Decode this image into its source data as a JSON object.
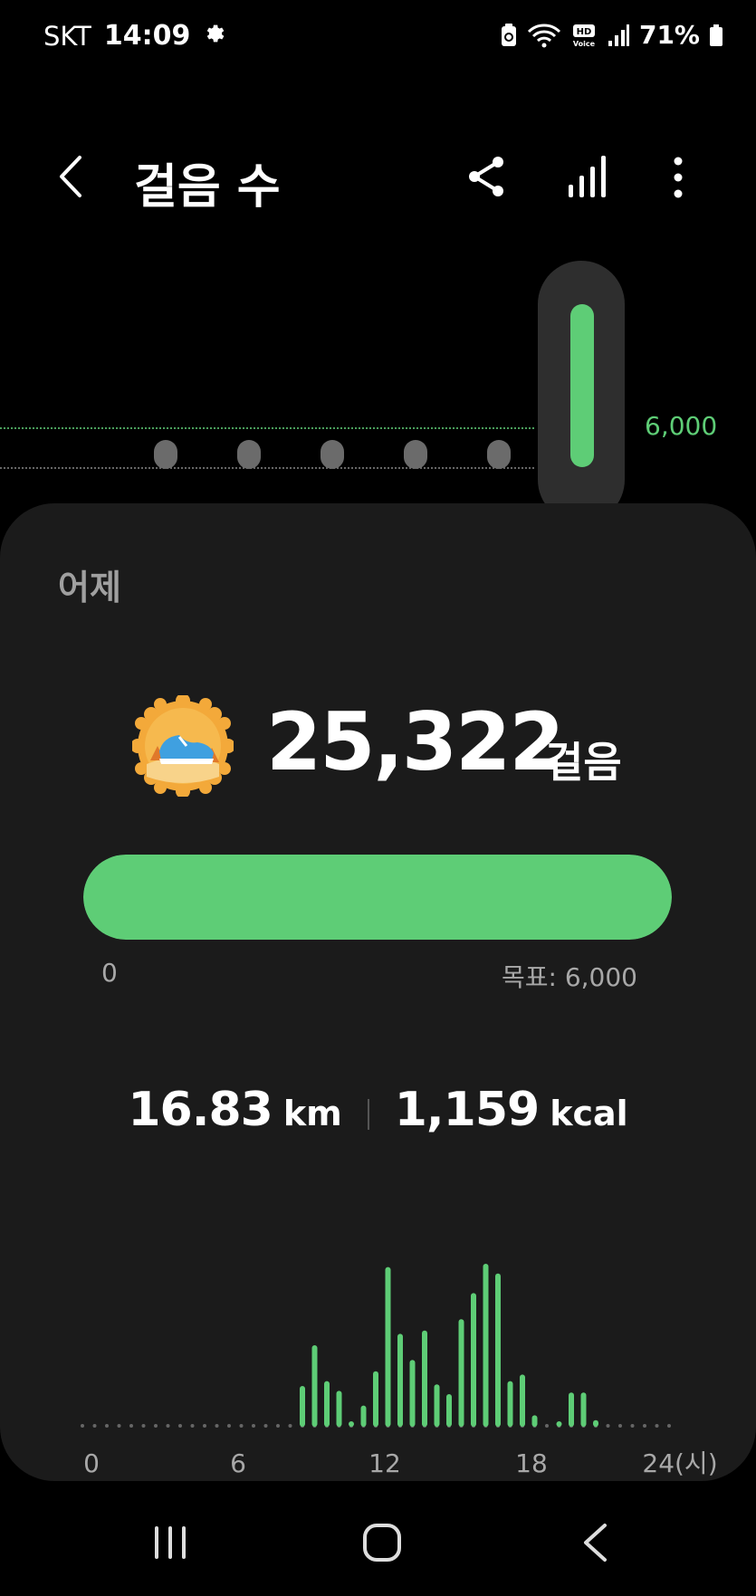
{
  "status_bar": {
    "carrier": "SKT",
    "time": "14:09",
    "battery": "71%",
    "icons": [
      "settings-gear-icon",
      "recycle-icon",
      "wifi-icon",
      "hd-voice-icon",
      "signal-icon",
      "battery-icon"
    ]
  },
  "header": {
    "title": "걸음 수",
    "icons": [
      "back-arrow-icon",
      "share-icon",
      "bar-chart-icon",
      "more-vertical-icon"
    ]
  },
  "weekly": {
    "goal_label": "6,000",
    "days_shown": 6,
    "selected_fraction_of_goal": 1.0
  },
  "summary": {
    "day_label": "어제",
    "steps": "25,322",
    "steps_unit": "걸음",
    "badge_icon": "sneaker-badge-icon",
    "progress_fraction": 1.0,
    "progress_min": "0",
    "progress_goal": "목표: 6,000",
    "distance_value": "16.83",
    "distance_unit": "km",
    "calories_value": "1,159",
    "calories_unit": "kcal"
  },
  "colors": {
    "accent": "#5ecd76",
    "card": "#1b1b1b",
    "muted_text": "#a8a8a8"
  },
  "chart_data": {
    "type": "bar",
    "title": "",
    "xlabel": "",
    "ylabel": "",
    "x_tick_labels": [
      "0",
      "6",
      "12",
      "18",
      "24(시)"
    ],
    "x_range": [
      0,
      24
    ],
    "ylim": [
      0,
      1
    ],
    "bar_interval_hours": 0.5,
    "x": [
      9.0,
      9.5,
      10.0,
      10.5,
      11.0,
      11.5,
      12.0,
      12.5,
      13.0,
      13.5,
      14.0,
      14.5,
      15.0,
      15.5,
      16.0,
      16.5,
      17.0,
      17.5,
      18.0,
      18.5,
      19.0,
      19.5,
      20.0,
      20.5,
      21.0,
      21.5
    ],
    "values": [
      0.25,
      0.5,
      0.28,
      0.22,
      0.03,
      0.13,
      0.34,
      0.98,
      0.57,
      0.41,
      0.59,
      0.26,
      0.2,
      0.66,
      0.82,
      1.0,
      0.94,
      0.28,
      0.32,
      0.07,
      0.0,
      0.03,
      0.21,
      0.21,
      0.04,
      0.0
    ],
    "grid": false,
    "legend": "none"
  },
  "nav": {
    "icons": [
      "recent-apps-icon",
      "home-icon",
      "back-icon"
    ]
  }
}
